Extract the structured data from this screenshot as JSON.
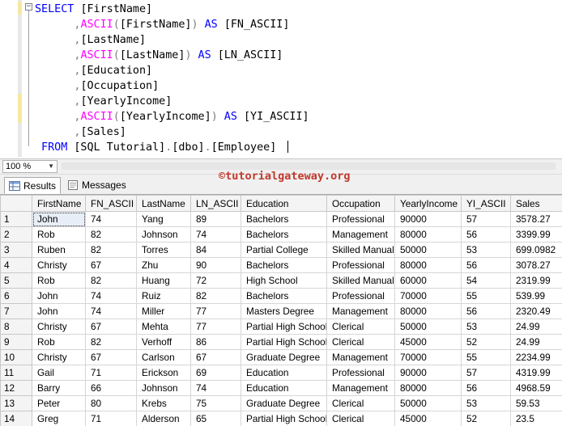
{
  "editor": {
    "lines": [
      [
        [
          "kw",
          "SELECT "
        ],
        [
          "t",
          "[FirstName]"
        ]
      ],
      [
        [
          "t",
          "      "
        ],
        [
          "op",
          ","
        ],
        [
          "fn",
          "ASCII"
        ],
        [
          "op",
          "("
        ],
        [
          "t",
          "[FirstName]"
        ],
        [
          "op",
          ")"
        ],
        [
          "kw",
          " AS "
        ],
        [
          "t",
          "[FN_ASCII]"
        ]
      ],
      [
        [
          "t",
          "      "
        ],
        [
          "op",
          ","
        ],
        [
          "t",
          "[LastName]"
        ]
      ],
      [
        [
          "t",
          "      "
        ],
        [
          "op",
          ","
        ],
        [
          "fn",
          "ASCII"
        ],
        [
          "op",
          "("
        ],
        [
          "t",
          "[LastName]"
        ],
        [
          "op",
          ")"
        ],
        [
          "kw",
          " AS "
        ],
        [
          "t",
          "[LN_ASCII]"
        ]
      ],
      [
        [
          "t",
          "      "
        ],
        [
          "op",
          ","
        ],
        [
          "t",
          "[Education]"
        ]
      ],
      [
        [
          "t",
          "      "
        ],
        [
          "op",
          ","
        ],
        [
          "t",
          "[Occupation]"
        ]
      ],
      [
        [
          "t",
          "      "
        ],
        [
          "op",
          ","
        ],
        [
          "t",
          "[YearlyIncome]"
        ]
      ],
      [
        [
          "t",
          "      "
        ],
        [
          "op",
          ","
        ],
        [
          "fn",
          "ASCII"
        ],
        [
          "op",
          "("
        ],
        [
          "t",
          "[YearlyIncome]"
        ],
        [
          "op",
          ")"
        ],
        [
          "kw",
          " AS "
        ],
        [
          "t",
          "[YI_ASCII]"
        ]
      ],
      [
        [
          "t",
          "      "
        ],
        [
          "op",
          ","
        ],
        [
          "t",
          "[Sales]"
        ]
      ],
      [
        [
          "kw",
          " FROM "
        ],
        [
          "t",
          "[SQL Tutorial]"
        ],
        [
          "op",
          "."
        ],
        [
          "t",
          "[dbo]"
        ],
        [
          "op",
          "."
        ],
        [
          "t",
          "[Employee]"
        ]
      ]
    ]
  },
  "zoom": {
    "value": "100 %"
  },
  "tabs": {
    "results": "Results",
    "messages": "Messages"
  },
  "watermark": "©tutorialgateway.org",
  "results": {
    "columns": [
      "FirstName",
      "FN_ASCII",
      "LastName",
      "LN_ASCII",
      "Education",
      "Occupation",
      "YearlyIncome",
      "YI_ASCII",
      "Sales"
    ],
    "rows": [
      [
        "1",
        "John",
        "74",
        "Yang",
        "89",
        "Bachelors",
        "Professional",
        "90000",
        "57",
        "3578.27"
      ],
      [
        "2",
        "Rob",
        "82",
        "Johnson",
        "74",
        "Bachelors",
        "Management",
        "80000",
        "56",
        "3399.99"
      ],
      [
        "3",
        "Ruben",
        "82",
        "Torres",
        "84",
        "Partial College",
        "Skilled Manual",
        "50000",
        "53",
        "699.0982"
      ],
      [
        "4",
        "Christy",
        "67",
        "Zhu",
        "90",
        "Bachelors",
        "Professional",
        "80000",
        "56",
        "3078.27"
      ],
      [
        "5",
        "Rob",
        "82",
        "Huang",
        "72",
        "High School",
        "Skilled Manual",
        "60000",
        "54",
        "2319.99"
      ],
      [
        "6",
        "John",
        "74",
        "Ruiz",
        "82",
        "Bachelors",
        "Professional",
        "70000",
        "55",
        "539.99"
      ],
      [
        "7",
        "John",
        "74",
        "Miller",
        "77",
        "Masters Degree",
        "Management",
        "80000",
        "56",
        "2320.49"
      ],
      [
        "8",
        "Christy",
        "67",
        "Mehta",
        "77",
        "Partial High School",
        "Clerical",
        "50000",
        "53",
        "24.99"
      ],
      [
        "9",
        "Rob",
        "82",
        "Verhoff",
        "86",
        "Partial High School",
        "Clerical",
        "45000",
        "52",
        "24.99"
      ],
      [
        "10",
        "Christy",
        "67",
        "Carlson",
        "67",
        "Graduate Degree",
        "Management",
        "70000",
        "55",
        "2234.99"
      ],
      [
        "11",
        "Gail",
        "71",
        "Erickson",
        "69",
        "Education",
        "Professional",
        "90000",
        "57",
        "4319.99"
      ],
      [
        "12",
        "Barry",
        "66",
        "Johnson",
        "74",
        "Education",
        "Management",
        "80000",
        "56",
        "4968.59"
      ],
      [
        "13",
        "Peter",
        "80",
        "Krebs",
        "75",
        "Graduate Degree",
        "Clerical",
        "50000",
        "53",
        "59.53"
      ],
      [
        "14",
        "Greg",
        "71",
        "Alderson",
        "65",
        "Partial High School",
        "Clerical",
        "45000",
        "52",
        "23.5"
      ]
    ]
  }
}
